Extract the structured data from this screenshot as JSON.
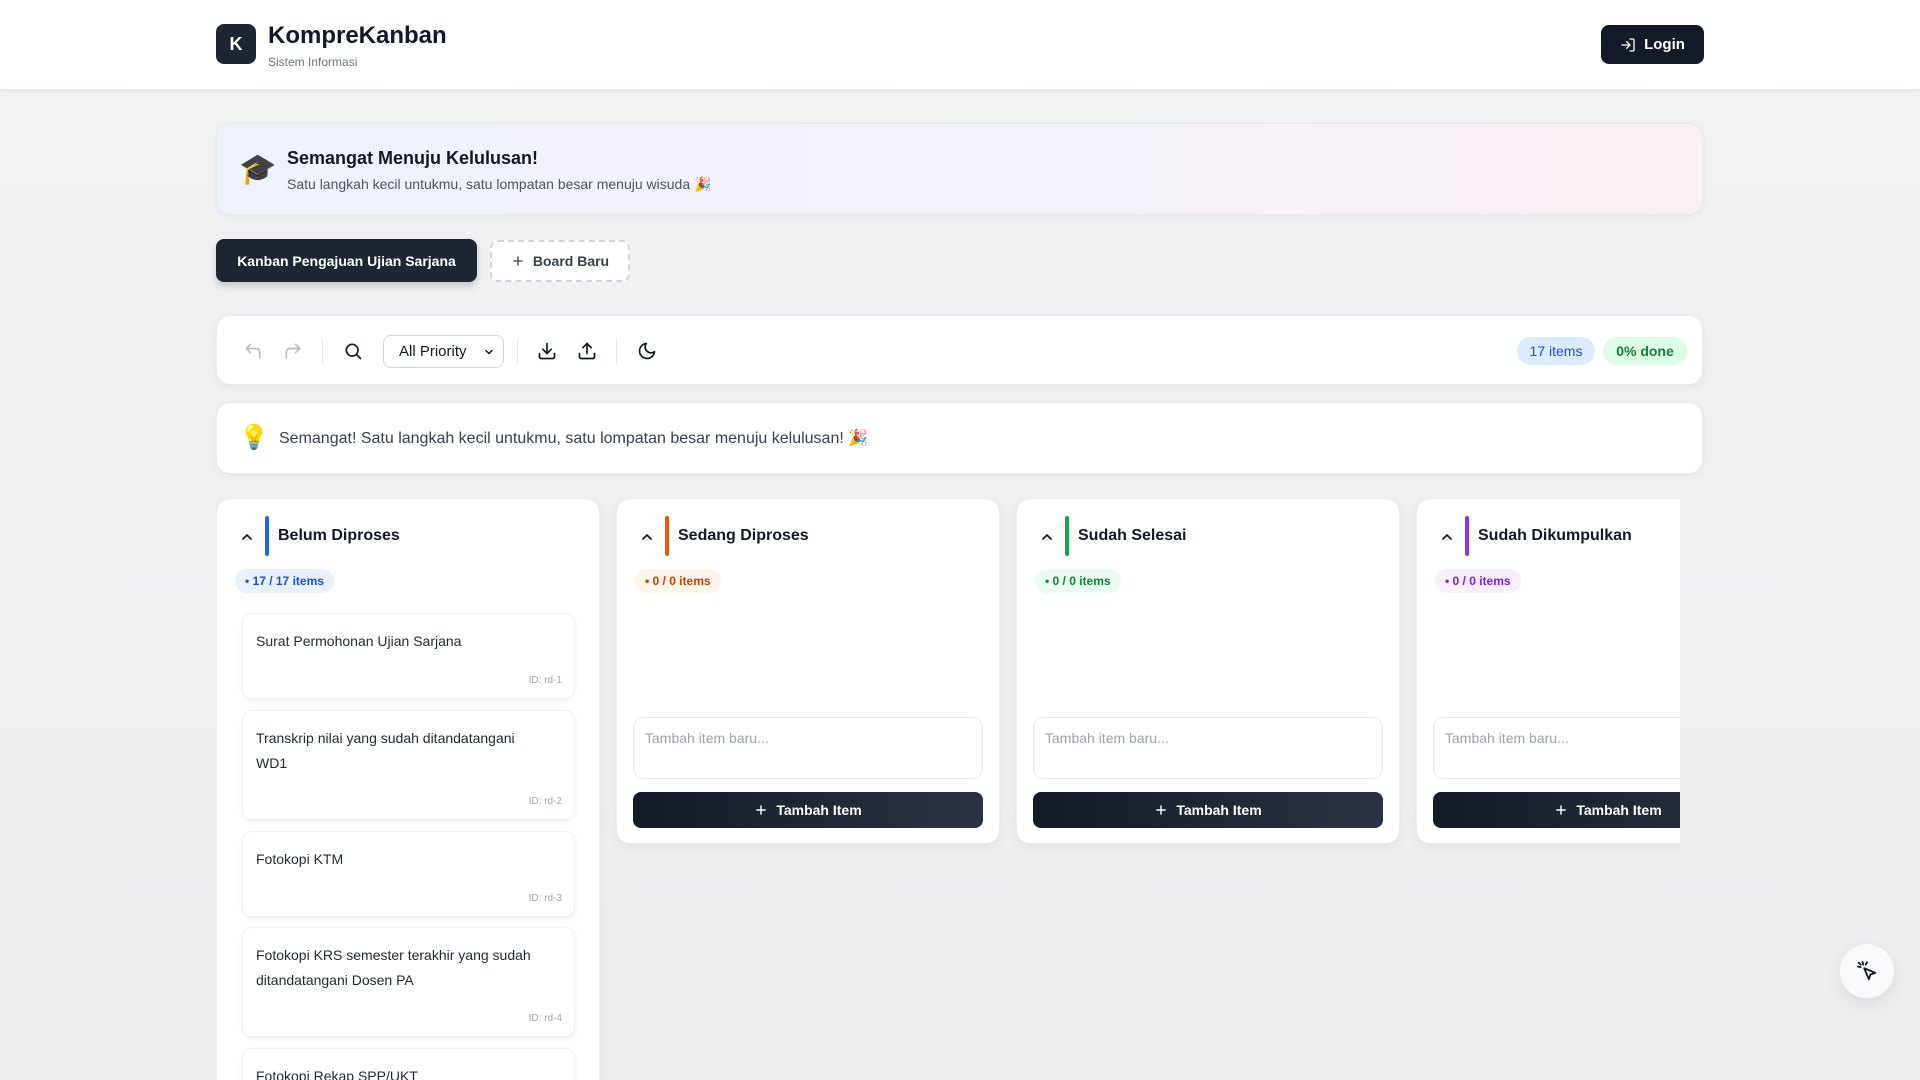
{
  "header": {
    "logo_letter": "K",
    "title": "KompreKanban",
    "subtitle": "Sistem Informasi",
    "login_label": "Login"
  },
  "banner": {
    "icon": "graduation-cap-icon",
    "title": "Semangat Menuju Kelulusan!",
    "subtitle": "Satu langkah kecil untukmu, satu lompatan besar menuju wisuda 🎉"
  },
  "tabs": {
    "active_label": "Kanban Pengajuan Ujian Sarjana",
    "new_label": "Board Baru"
  },
  "toolbar": {
    "priority_selected": "All Priority",
    "priority_options": [
      "All Priority"
    ],
    "items_badge": "17 items",
    "done_badge": "0% done"
  },
  "tip": {
    "icon": "lightbulb-icon",
    "text": "Semangat! Satu langkah kecil untukmu, satu lompatan besar menuju kelulusan! 🎉"
  },
  "columns": [
    {
      "title": "Belum Diproses",
      "color": "#2563eb",
      "badge": "• 17 / 17 items",
      "badge_bg": "#e8f0fe",
      "badge_color": "#1d4ed8",
      "cards": [
        {
          "text": "Surat Permohonan Ujian Sarjana",
          "id": "ID: rd-1"
        },
        {
          "text": "Transkrip nilai yang sudah ditandatangani WD1",
          "id": "ID: rd-2"
        },
        {
          "text": "Fotokopi KTM",
          "id": "ID: rd-3"
        },
        {
          "text": "Fotokopi KRS semester terakhir yang sudah ditandatangani Dosen PA",
          "id": "ID: rd-4"
        },
        {
          "text": "Fotokopi Rekap SPP/UKT",
          "id": ""
        }
      ]
    },
    {
      "title": "Sedang Diproses",
      "color": "#ea580c",
      "badge": "• 0 / 0 items",
      "badge_bg": "#fff4ea",
      "badge_color": "#c2410c",
      "placeholder": "Tambah item baru...",
      "add_label": "Tambah Item"
    },
    {
      "title": "Sudah Selesai",
      "color": "#16a34a",
      "badge": "• 0 / 0 items",
      "badge_bg": "#eafaf0",
      "badge_color": "#15803d",
      "placeholder": "Tambah item baru...",
      "add_label": "Tambah Item"
    },
    {
      "title": "Sudah Dikumpulkan",
      "color": "#9333ea",
      "badge": "• 0 / 0 items",
      "badge_bg": "#f6edfd",
      "badge_color": "#7e22ce",
      "placeholder": "Tambah item baru...",
      "add_label": "Tambah Item"
    }
  ],
  "fab": {
    "icon": "cursor-sparkle-icon"
  }
}
